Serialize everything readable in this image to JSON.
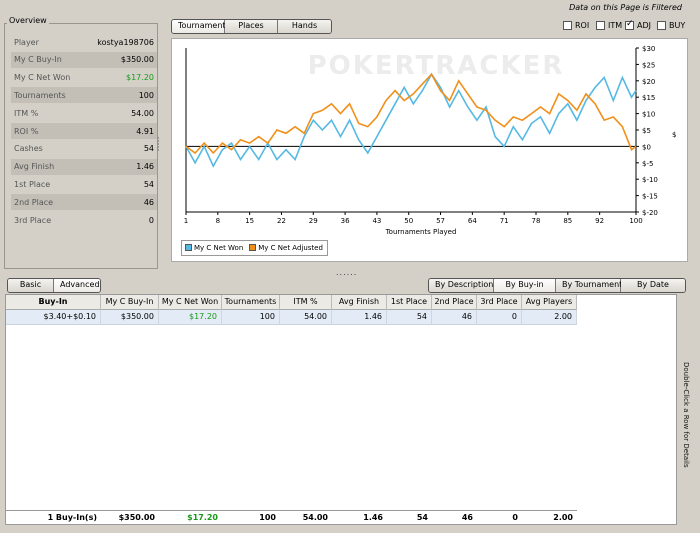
{
  "header": {
    "filter_notice": "Data on this Page is Filtered"
  },
  "overview": {
    "title": "Overview",
    "rows": [
      {
        "label": "Player",
        "value": "kostya198706"
      },
      {
        "label": "My C Buy-In",
        "value": "$350.00"
      },
      {
        "label": "My C Net Won",
        "value": "$17.20"
      },
      {
        "label": "Tournaments",
        "value": "100"
      },
      {
        "label": "ITM %",
        "value": "54.00"
      },
      {
        "label": "ROI %",
        "value": "4.91"
      },
      {
        "label": "Cashes",
        "value": "54"
      },
      {
        "label": "Avg Finish",
        "value": "1.46"
      },
      {
        "label": "1st Place",
        "value": "54"
      },
      {
        "label": "2nd Place",
        "value": "46"
      },
      {
        "label": "3rd Place",
        "value": "0"
      }
    ]
  },
  "graph_tabs": {
    "tournament": "Tournament",
    "places": "Places",
    "hands": "Hands"
  },
  "options": {
    "roi": "ROI",
    "itm": "ITM",
    "adj": "ADJ",
    "buy": "BUY",
    "adj_checked": true
  },
  "chart_data": {
    "type": "line",
    "watermark": "POKERTRACKER",
    "xlabel": "Tournaments Played",
    "ylabel": "$",
    "x_ticks": [
      "1",
      "8",
      "15",
      "22",
      "29",
      "36",
      "43",
      "50",
      "57",
      "64",
      "71",
      "78",
      "85",
      "92",
      "100"
    ],
    "y_ticks": [
      "$30",
      "$25",
      "$20",
      "$15",
      "$10",
      "$5",
      "$0",
      "$-5",
      "$-10",
      "$-15",
      "$-20"
    ],
    "xlim": [
      1,
      100
    ],
    "ylim": [
      -20,
      30
    ],
    "series": [
      {
        "name": "My C Net Won",
        "color": "#55b9e3",
        "x": [
          1,
          3,
          5,
          7,
          9,
          11,
          13,
          15,
          17,
          19,
          21,
          23,
          25,
          27,
          29,
          31,
          33,
          35,
          37,
          39,
          41,
          43,
          45,
          47,
          49,
          51,
          53,
          55,
          57,
          59,
          61,
          63,
          65,
          67,
          69,
          71,
          73,
          75,
          77,
          79,
          81,
          83,
          85,
          87,
          89,
          91,
          93,
          95,
          97,
          99,
          100
        ],
        "values": [
          0,
          -5,
          0,
          -6,
          -1,
          1,
          -4,
          0,
          -4,
          1,
          -4,
          -1,
          -4,
          3,
          8,
          5,
          8,
          3,
          8,
          2,
          -2,
          3,
          8,
          13,
          18,
          13,
          17,
          22,
          18,
          12,
          17,
          12,
          8,
          12,
          3,
          0,
          6,
          2,
          7,
          9,
          4,
          10,
          13,
          8,
          14,
          18,
          21,
          14,
          21,
          15,
          17
        ]
      },
      {
        "name": "My C Net Adjusted",
        "color": "#f0901a",
        "x": [
          1,
          3,
          5,
          7,
          9,
          11,
          13,
          15,
          17,
          19,
          21,
          23,
          25,
          27,
          29,
          31,
          33,
          35,
          37,
          39,
          41,
          43,
          45,
          47,
          49,
          51,
          53,
          55,
          57,
          59,
          61,
          63,
          65,
          67,
          69,
          71,
          73,
          75,
          77,
          79,
          81,
          83,
          85,
          87,
          89,
          91,
          93,
          95,
          97,
          99,
          100
        ],
        "values": [
          0,
          -2,
          1,
          -2,
          1,
          -1,
          2,
          1,
          3,
          1,
          5,
          4,
          6,
          4,
          10,
          11,
          13,
          10,
          13,
          7,
          6,
          9,
          14,
          17,
          14,
          16,
          19,
          22,
          17,
          14,
          20,
          16,
          12,
          11,
          8,
          6,
          9,
          8,
          10,
          12,
          10,
          16,
          14,
          11,
          16,
          13,
          8,
          9,
          6,
          -1,
          0
        ]
      }
    ],
    "grid": "horizontal zero line"
  },
  "legend": {
    "won": "My C Net Won",
    "adj": "My C Net Adjusted"
  },
  "bottom_tabs": {
    "basic": "Basic",
    "advanced": "Advanced"
  },
  "view_tabs": {
    "by_description": "By Description",
    "by_buyin": "By Buy-in",
    "by_tournament": "By Tournament",
    "by_date": "By Date"
  },
  "table": {
    "columns": [
      "Buy-In",
      "My C Buy-In",
      "My C Net Won",
      "Tournaments",
      "ITM %",
      "Avg Finish",
      "1st Place",
      "2nd Place",
      "3rd Place",
      "Avg Players"
    ],
    "rows": [
      [
        "$3.40+$0.10",
        "$350.00",
        "$17.20",
        "100",
        "54.00",
        "1.46",
        "54",
        "46",
        "0",
        "2.00"
      ]
    ],
    "totals": [
      "1 Buy-In(s)",
      "$350.00",
      "$17.20",
      "100",
      "54.00",
      "1.46",
      "54",
      "46",
      "0",
      "2.00"
    ],
    "side_hint": "Double-Click a Row for Details"
  }
}
